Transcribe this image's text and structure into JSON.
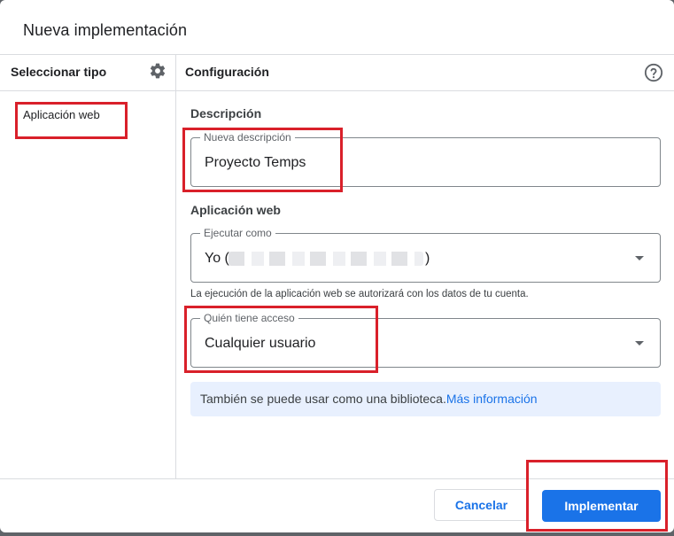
{
  "dialog": {
    "title": "Nueva implementación"
  },
  "left_panel": {
    "header": "Seleccionar tipo",
    "settings_icon": "gear-icon",
    "items": [
      {
        "label": "Aplicación web"
      }
    ]
  },
  "right_panel": {
    "header": "Configuración",
    "help_icon": "help-circle-icon",
    "description_section": {
      "label": "Descripción",
      "field_legend": "Nueva descripción",
      "field_value": "Proyecto Temps"
    },
    "webapp_section": {
      "label": "Aplicación web",
      "execute_as": {
        "legend": "Ejecutar como",
        "value_prefix": "Yo (",
        "value_suffix": ")",
        "icon": "dropdown-arrow-icon"
      },
      "execute_hint": "La ejecución de la aplicación web se autorizará con los datos de tu cuenta.",
      "access": {
        "legend": "Quién tiene acceso",
        "value": "Cualquier usuario",
        "icon": "dropdown-arrow-icon"
      }
    },
    "info": {
      "text": "También se puede usar como una biblioteca.",
      "link": "Más información"
    }
  },
  "footer": {
    "cancel_label": "Cancelar",
    "deploy_label": "Implementar"
  },
  "colors": {
    "accent": "#1a73e8",
    "annotation": "#d9202a",
    "info_background": "#e8f0fe"
  }
}
